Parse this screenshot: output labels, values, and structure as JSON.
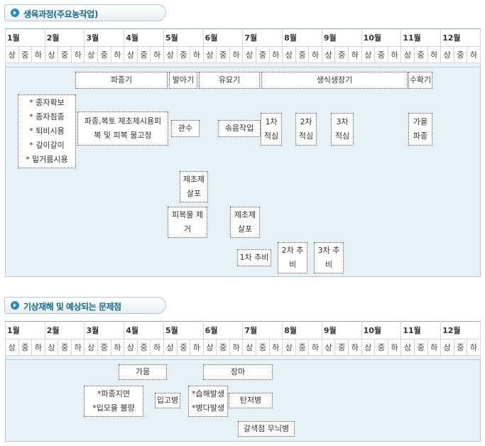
{
  "section1": {
    "title": "생육과정(주요농작업)"
  },
  "section2": {
    "title": "기상재해 및 예상되는 문제점"
  },
  "months": [
    "1월",
    "2월",
    "3월",
    "4월",
    "5월",
    "6월",
    "7월",
    "8월",
    "9월",
    "10월",
    "11월",
    "12월"
  ],
  "periods": [
    "상",
    "중",
    "하"
  ],
  "stages": {
    "sowing": "파종기",
    "germination": "발아기",
    "seedling": "유묘기",
    "vegetative": "생식생장기",
    "harvest": "수확기"
  },
  "tasks": {
    "prep": [
      "* 종자확보",
      "* 종자침종",
      "* 퇴비시용",
      "* 깊이갈이",
      "* 밑거름시용"
    ],
    "sowing_work": "파종,복토 제초제시용피\n복 및 피복 물고정",
    "irrigation": "관수",
    "thinning": "솎음작업",
    "pinch1": "1차\n적심",
    "pinch2": "2차\n적심",
    "pinch3": "3차\n적심",
    "fall_sowing": "가을\n파종",
    "herbicide1": "제초제\n살포",
    "mulch_removal": "피복물 제\n거",
    "herbicide2": "제초제\n살포",
    "fert1": "1차 추비",
    "fert2": "2차 추\n비",
    "fert3": "3차 추\n비"
  },
  "problems": {
    "drought": "가뭄",
    "rainy": "장마",
    "delay": [
      "*파종지연",
      "*입모율 불량"
    ],
    "damping": "입고병",
    "wet": [
      "*습해발생",
      "*병다발생"
    ],
    "anthracnose": "탄저병",
    "brownspot": "갈색점 무늬병"
  }
}
